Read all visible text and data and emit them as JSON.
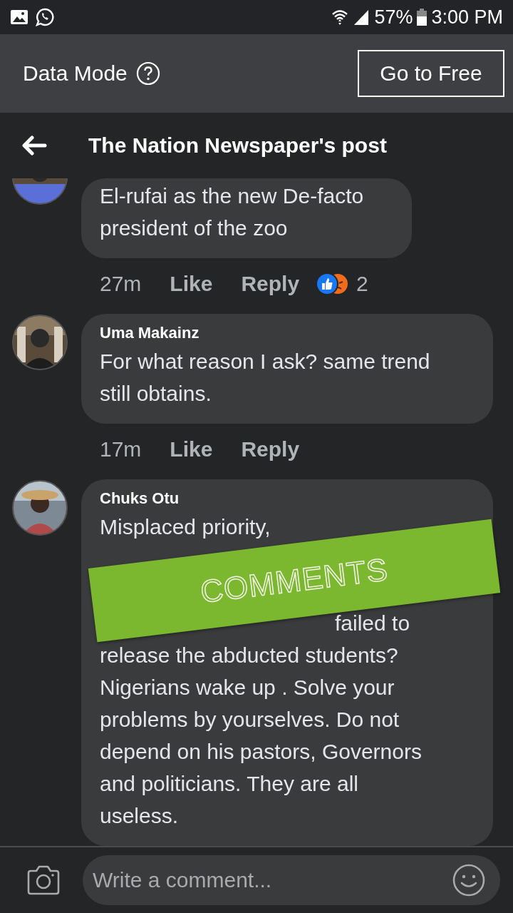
{
  "status_bar": {
    "battery": "57%",
    "time": "3:00 PM"
  },
  "data_mode": {
    "label": "Data Mode",
    "button": "Go to Free"
  },
  "header": {
    "title": "The Nation Newspaper's post"
  },
  "comments": [
    {
      "kind": "partial",
      "lines": [
        "El-rufai as the new De-facto",
        "president of the zoo"
      ],
      "time": "27m",
      "like": "Like",
      "reply": "Reply",
      "reaction_count": "2"
    },
    {
      "kind": "full",
      "author": "Uma Makainz",
      "lines": [
        "For what reason I ask?  same trend",
        "still obtains."
      ],
      "time": "17m",
      "like": "Like",
      "reply": "Reply"
    },
    {
      "kind": "covered",
      "author": "Chuks Otu",
      "first_line": "Misplaced priority,",
      "after_cover": "failed to",
      "lines": [
        "release the abducted students?",
        "Nigerians wake up . Solve your",
        "problems by yourselves. Do not",
        "depend on his pastors, Governors",
        "and politicians. They are all",
        "useless."
      ],
      "sticker": "COMMENTS"
    }
  ],
  "composer": {
    "placeholder": "Write a comment..."
  }
}
